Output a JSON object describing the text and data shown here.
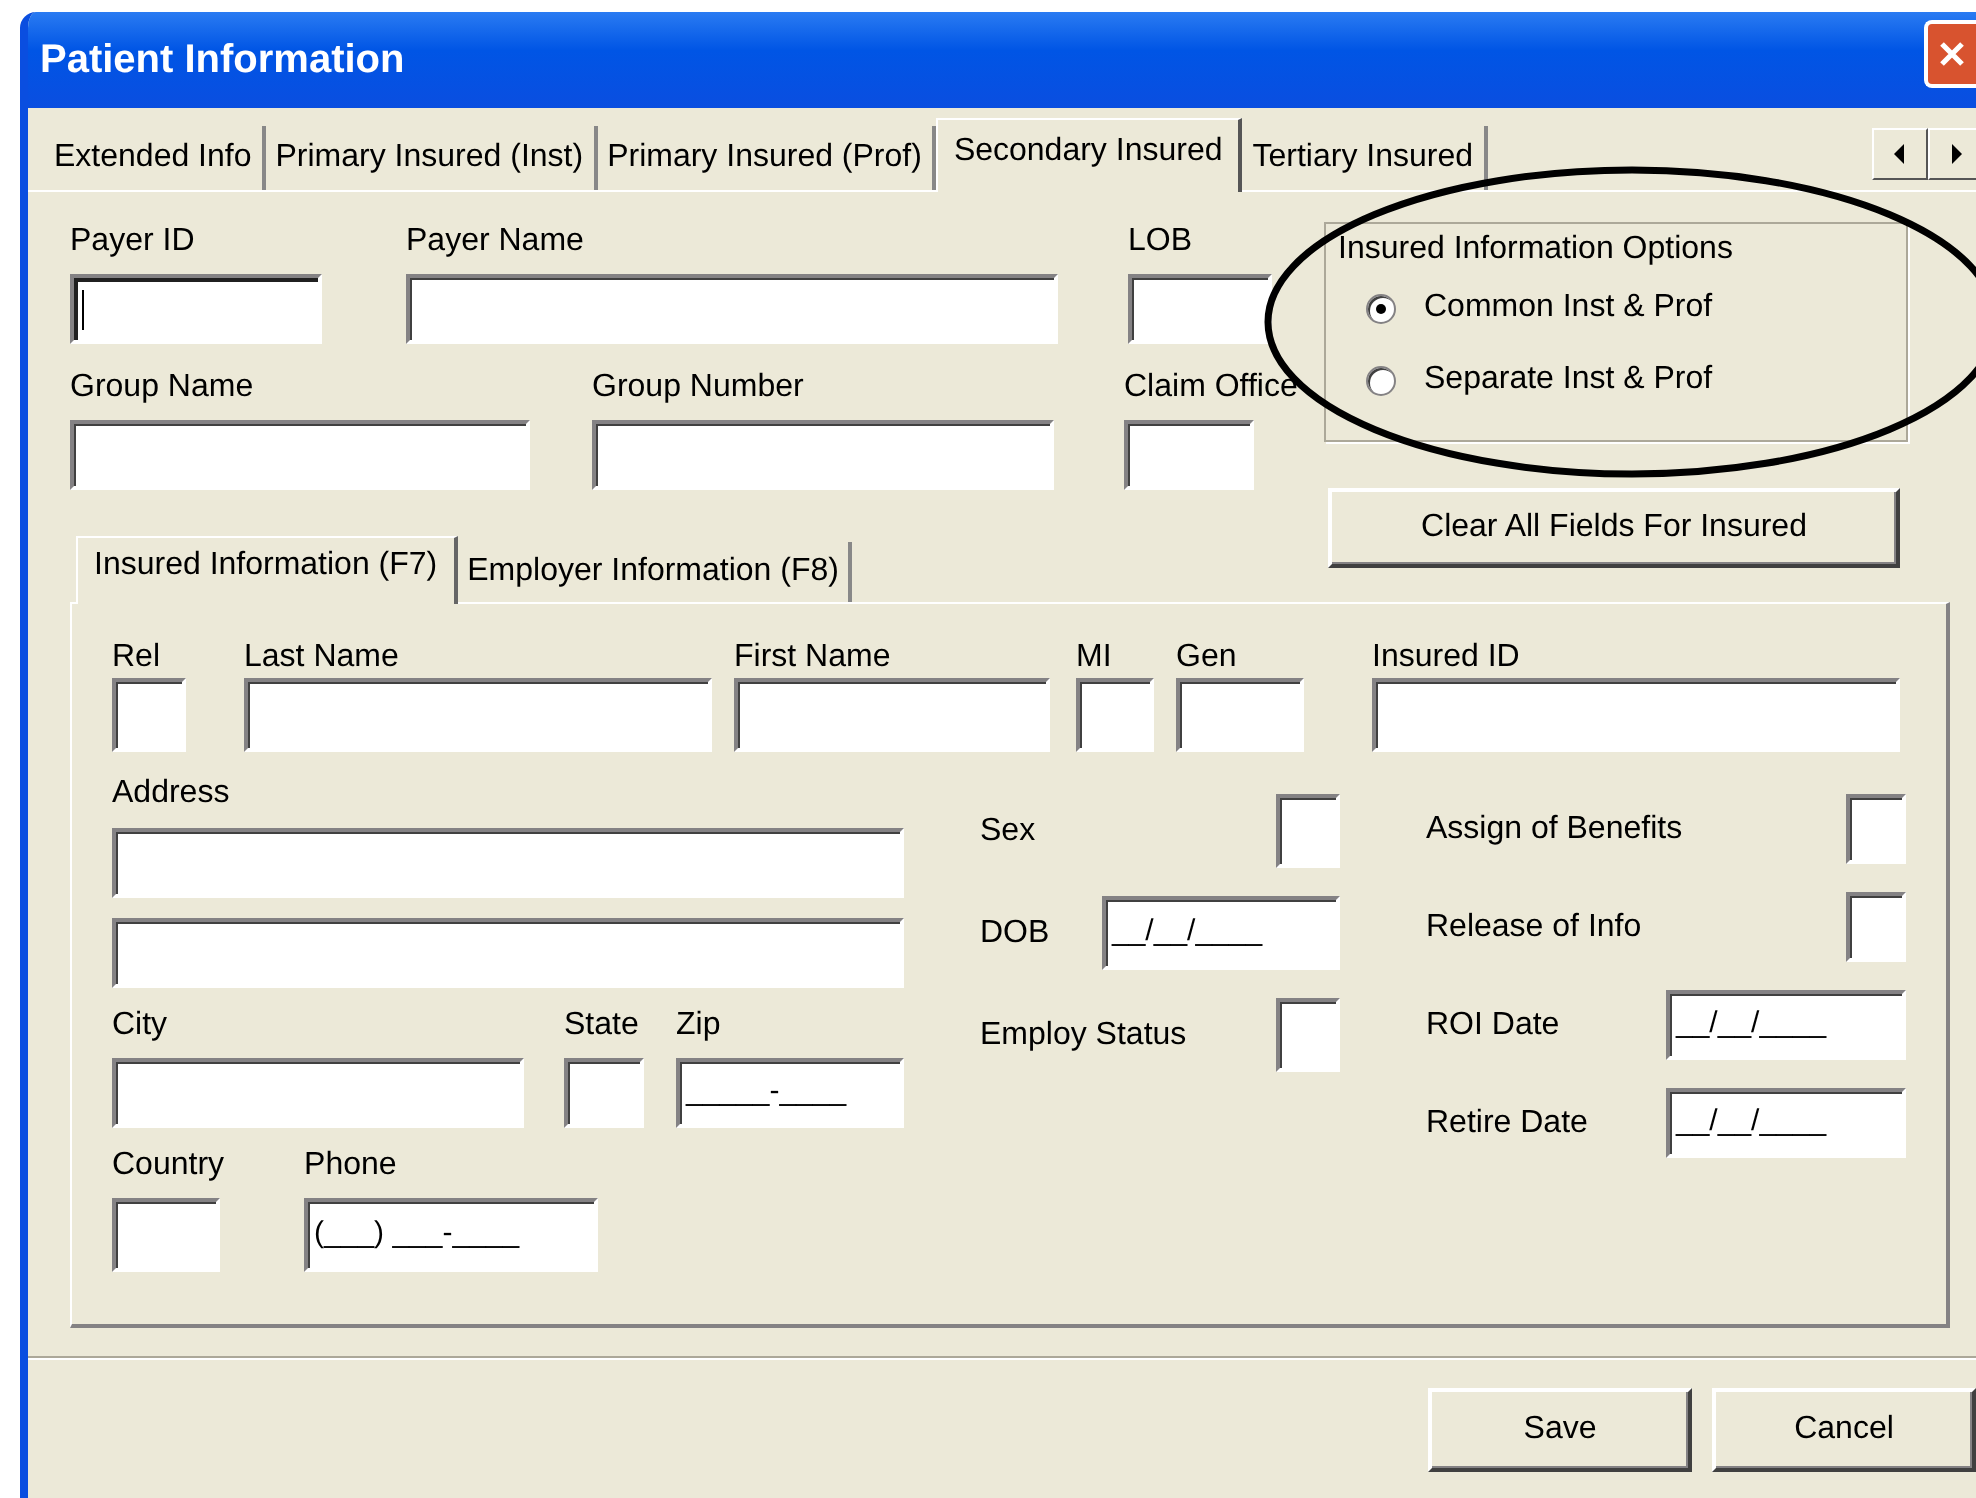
{
  "window": {
    "title": "Patient Information"
  },
  "tabs": [
    {
      "label": "Extended Info",
      "selected": false
    },
    {
      "label": "Primary Insured (Inst)",
      "selected": false
    },
    {
      "label": "Primary Insured (Prof)",
      "selected": false
    },
    {
      "label": "Secondary Insured",
      "selected": true
    },
    {
      "label": "Tertiary Insured",
      "selected": false
    }
  ],
  "payer_row": [
    {
      "label": "Payer ID",
      "focused": true
    },
    {
      "label": "Payer Name",
      "focused": false
    },
    {
      "label": "LOB",
      "focused": false
    }
  ],
  "group_row": [
    {
      "label": "Group Name"
    },
    {
      "label": "Group Number"
    },
    {
      "label": "Claim Office"
    }
  ],
  "options": {
    "title": "Insured Information Options",
    "choices": [
      {
        "label": "Common Inst & Prof",
        "selected": true
      },
      {
        "label": "Separate Inst & Prof",
        "selected": false
      }
    ]
  },
  "clear_button": "Clear All Fields For Insured",
  "sub_tabs": [
    {
      "label": "Insured Information (F7)",
      "selected": true
    },
    {
      "label": "Employer Information (F8)",
      "selected": false
    }
  ],
  "name_row": [
    {
      "label": "Rel"
    },
    {
      "label": "Last Name"
    },
    {
      "label": "First Name"
    },
    {
      "label": "MI"
    },
    {
      "label": "Gen"
    },
    {
      "label": "Insured ID"
    }
  ],
  "address": {
    "label": "Address"
  },
  "city_row": [
    {
      "label": "City"
    },
    {
      "label": "State"
    },
    {
      "label": "Zip",
      "value": "_____-____"
    }
  ],
  "country_row": [
    {
      "label": "Country"
    },
    {
      "label": "Phone",
      "value": "(___) ___-____"
    }
  ],
  "middle_fields": [
    {
      "label": "Sex"
    },
    {
      "label": "DOB",
      "value": "__/__/____"
    },
    {
      "label": "Employ Status"
    }
  ],
  "right_fields": [
    {
      "label": "Assign of Benefits"
    },
    {
      "label": "Release of Info"
    },
    {
      "label": "ROI Date",
      "value": "__/__/____"
    },
    {
      "label": "Retire Date",
      "value": "__/__/____"
    }
  ],
  "buttons": [
    {
      "label": "Save"
    },
    {
      "label": "Cancel"
    }
  ]
}
